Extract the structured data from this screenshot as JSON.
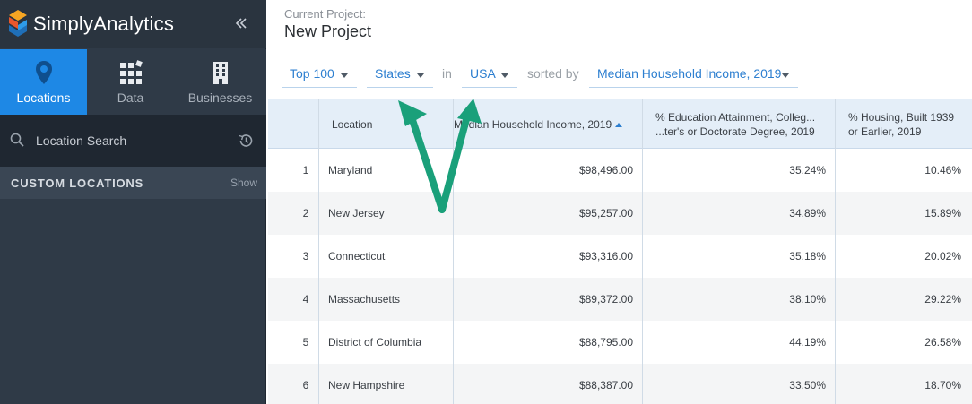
{
  "app": {
    "name": "SimplyAnalytics",
    "collapse_icon": "double-chevron-left-icon"
  },
  "sidebar": {
    "tabs": [
      {
        "label": "Locations",
        "icon": "map-pin-icon",
        "active": true
      },
      {
        "label": "Data",
        "icon": "grid-icon",
        "active": false
      },
      {
        "label": "Businesses",
        "icon": "building-icon",
        "active": false
      }
    ],
    "search": {
      "placeholder": "Location Search",
      "value": ""
    },
    "custom_locations": {
      "title": "CUSTOM LOCATIONS",
      "toggle": "Show"
    }
  },
  "project": {
    "label": "Current Project:",
    "name": "New Project"
  },
  "filters": {
    "top": "Top 100",
    "geo_type": "States",
    "in_text": "in",
    "region": "USA",
    "sorted_text": "sorted by",
    "sort_variable": "Median Household Income, 2019"
  },
  "table": {
    "columns": {
      "location": "Location",
      "income": "Median Household Income, 2019",
      "education_line1": "% Education Attainment, Colleg...",
      "education_line2": "...ter's or Doctorate Degree, 2019",
      "housing_line1": "% Housing, Built 1939",
      "housing_line2": "or Earlier, 2019"
    },
    "rows": [
      {
        "rank": "1",
        "location": "Maryland",
        "income": "$98,496.00",
        "education": "35.24%",
        "housing": "10.46%"
      },
      {
        "rank": "2",
        "location": "New Jersey",
        "income": "$95,257.00",
        "education": "34.89%",
        "housing": "15.89%"
      },
      {
        "rank": "3",
        "location": "Connecticut",
        "income": "$93,316.00",
        "education": "35.18%",
        "housing": "20.02%"
      },
      {
        "rank": "4",
        "location": "Massachusetts",
        "income": "$89,372.00",
        "education": "38.10%",
        "housing": "29.22%"
      },
      {
        "rank": "5",
        "location": "District of Columbia",
        "income": "$88,795.00",
        "education": "44.19%",
        "housing": "26.58%"
      },
      {
        "rank": "6",
        "location": "New Hampshire",
        "income": "$88,387.00",
        "education": "33.50%",
        "housing": "18.70%"
      }
    ]
  },
  "colors": {
    "accent": "#1e88e5",
    "link": "#2d7fd0",
    "sidebar_bg": "#2f3a47",
    "annotation_arrow": "#1aa07a"
  }
}
